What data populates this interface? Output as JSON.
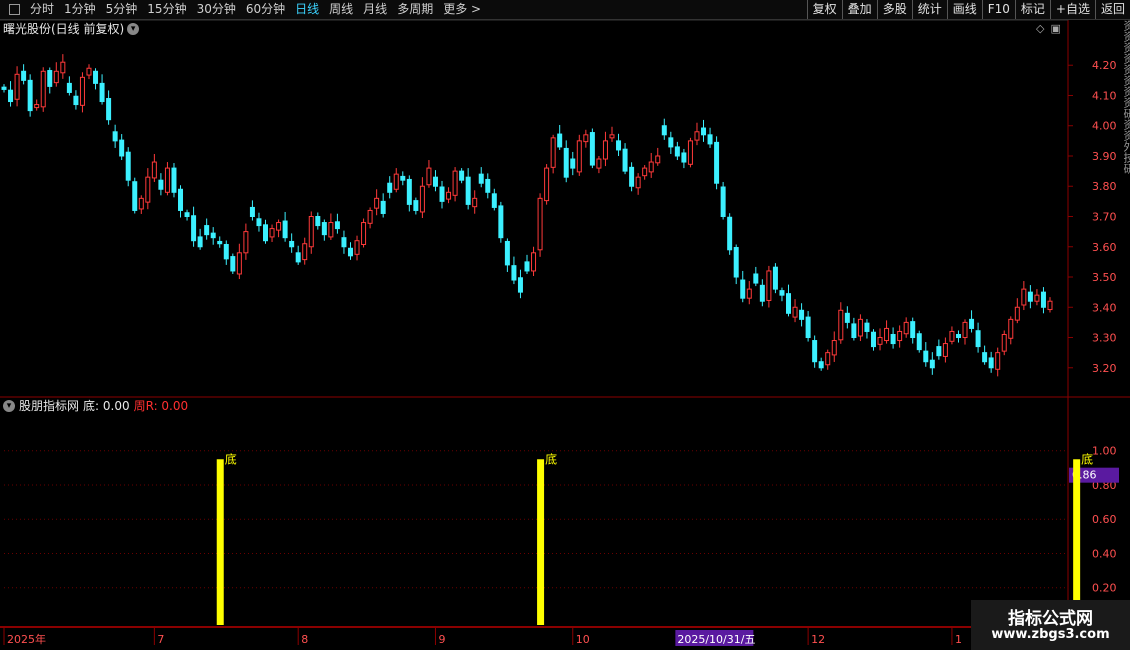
{
  "toolbar": {
    "periods": [
      "分时",
      "1分钟",
      "5分钟",
      "15分钟",
      "30分钟",
      "60分钟",
      "日线",
      "周线",
      "月线",
      "多周期",
      "更多 >"
    ],
    "active": "日线",
    "right_buttons": [
      "复权",
      "叠加",
      "多股",
      "统计",
      "画线",
      "F10",
      "标记",
      "+自选",
      "返回"
    ]
  },
  "chart_title": "曙光股份(日线 前复权)",
  "indicator": {
    "name": "股朋指标网",
    "label_di": "底: 0.00",
    "label_zhou": "周R: 0.00",
    "marker_text": "底",
    "current_value": "0.86"
  },
  "right_strip_text": "资资资资资资资资研资资外技研",
  "watermark": {
    "line1": "指标公式网",
    "line2": "www.zbgs3.com"
  },
  "colors": {
    "up": "#ff3a3a",
    "down": "#3cf0ff",
    "signal": "#ffff00",
    "axis": "#8b0000"
  },
  "chart_data": {
    "type": "candlestick",
    "y_ticks": [
      "4.20",
      "4.10",
      "4.00",
      "3.90",
      "3.80",
      "3.70",
      "3.60",
      "3.50",
      "3.40",
      "3.30",
      "3.20"
    ],
    "ind_ticks": [
      "1.00",
      "0.80",
      "0.60",
      "0.40",
      "0.20"
    ],
    "x_labels": [
      {
        "text": "2025年",
        "idx": 0
      },
      {
        "text": "7",
        "idx": 23
      },
      {
        "text": "8",
        "idx": 45
      },
      {
        "text": "9",
        "idx": 66
      },
      {
        "text": "10",
        "idx": 87
      },
      {
        "text": "2025/10/31/五",
        "idx": 103
      },
      {
        "text": "12",
        "idx": 123
      },
      {
        "text": "1",
        "idx": 145
      }
    ],
    "signals_idx": [
      33,
      82,
      164
    ],
    "closes": [
      4.12,
      4.08,
      4.17,
      4.15,
      4.05,
      4.07,
      4.18,
      4.13,
      4.18,
      4.21,
      4.11,
      4.07,
      4.16,
      4.19,
      4.14,
      4.08,
      4.02,
      3.95,
      3.9,
      3.82,
      3.72,
      3.76,
      3.83,
      3.88,
      3.79,
      3.86,
      3.78,
      3.72,
      3.7,
      3.62,
      3.6,
      3.64,
      3.63,
      3.61,
      3.56,
      3.52,
      3.58,
      3.65,
      3.7,
      3.67,
      3.62,
      3.66,
      3.68,
      3.63,
      3.6,
      3.55,
      3.61,
      3.7,
      3.67,
      3.64,
      3.68,
      3.66,
      3.6,
      3.57,
      3.62,
      3.68,
      3.72,
      3.76,
      3.71,
      3.78,
      3.84,
      3.82,
      3.74,
      3.72,
      3.8,
      3.86,
      3.8,
      3.75,
      3.78,
      3.85,
      3.82,
      3.74,
      3.76,
      3.81,
      3.78,
      3.73,
      3.63,
      3.54,
      3.49,
      3.45,
      3.52,
      3.58,
      3.76,
      3.86,
      3.96,
      3.93,
      3.83,
      3.86,
      3.95,
      3.97,
      3.87,
      3.89,
      3.95,
      3.97,
      3.92,
      3.85,
      3.8,
      3.83,
      3.86,
      3.88,
      3.9,
      3.97,
      3.93,
      3.9,
      3.88,
      3.95,
      3.98,
      3.97,
      3.94,
      3.81,
      3.7,
      3.59,
      3.5,
      3.43,
      3.46,
      3.48,
      3.42,
      3.52,
      3.46,
      3.44,
      3.38,
      3.4,
      3.36,
      3.3,
      3.22,
      3.2,
      3.25,
      3.29,
      3.39,
      3.35,
      3.3,
      3.36,
      3.32,
      3.27,
      3.3,
      3.33,
      3.28,
      3.32,
      3.35,
      3.3,
      3.26,
      3.22,
      3.2,
      3.24,
      3.28,
      3.32,
      3.3,
      3.35,
      3.33,
      3.27,
      3.22,
      3.2,
      3.25,
      3.31,
      3.36,
      3.4,
      3.46,
      3.42,
      3.44,
      3.4,
      3.42
    ]
  }
}
